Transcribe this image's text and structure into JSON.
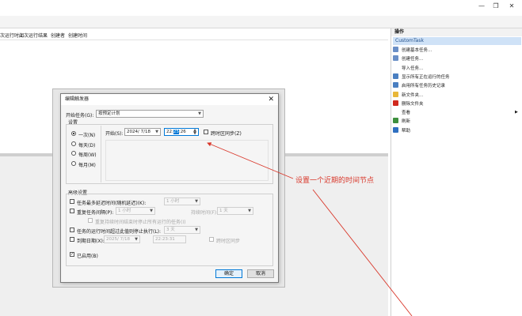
{
  "window": {
    "min": "—",
    "max": "❐",
    "close": "✕"
  },
  "columns": [
    "上次运行时间",
    "上次运行结果",
    "创建者",
    "创建时间"
  ],
  "right_pane": {
    "header": "操作",
    "selected": "CustomTask",
    "items": [
      {
        "icon": "create-basic-task-icon",
        "label": "创建基本任务...",
        "color": "#6a8fc7"
      },
      {
        "icon": "create-task-icon",
        "label": "创建任务...",
        "color": "#6a8fc7"
      },
      {
        "icon": "",
        "label": "导入任务...",
        "color": ""
      },
      {
        "icon": "running-tasks-icon",
        "label": "显示所有正在运行的任务",
        "color": "#4a7fc1"
      },
      {
        "icon": "history-icon",
        "label": "启用所有任务历史记录",
        "color": "#4a7fc1"
      },
      {
        "icon": "new-folder-icon",
        "label": "新文件夹...",
        "color": "#e8b73a"
      },
      {
        "icon": "delete-icon",
        "label": "删除文件夹",
        "color": "#d0281d"
      },
      {
        "icon": "view-icon",
        "label": "查看",
        "color": ""
      },
      {
        "icon": "refresh-icon",
        "label": "刷新",
        "color": "#3d8f3d"
      },
      {
        "icon": "help-icon",
        "label": "帮助",
        "color": "#2f6fc0"
      }
    ]
  },
  "dialog": {
    "title": "编辑触发器",
    "close": "✕",
    "begin_task_label": "开始任务(G):",
    "begin_task_value": "按预定计划",
    "settings_label": "设置",
    "schedule_options": [
      "一次(N)",
      "每天(D)",
      "每周(W)",
      "每月(M)"
    ],
    "selected_option": 0,
    "start_label": "开始(S):",
    "start_date": "2024/ 7/18",
    "start_time_h": "22:",
    "start_time_m": "25",
    "start_time_s": ":26",
    "sync_tz": "跨时区同步(Z)",
    "advanced_label": "高级设置",
    "delay_label": "任务最多延迟时间(随机延迟)(K):",
    "delay_value": "1 小时",
    "repeat_label": "重复任务间隔(P):",
    "repeat_value": "1 小时",
    "duration_label": "持续时间(F):",
    "duration_value": "1 天",
    "stop_at_end_label": "重复持续时间结束时停止所有运行的任务(I)",
    "stop_longer_label": "任务的运行时间超过此值则停止执行(L):",
    "stop_longer_value": "3 天",
    "expire_label": "到期日期(X):",
    "expire_date": "2025/ 7/18",
    "expire_time": "22:23:31",
    "expire_sync": "跨时区同步",
    "enabled_label": "已启用(B)",
    "ok": "确定",
    "cancel": "取消"
  },
  "annotation": {
    "text": "设置一个近期的时间节点",
    "color": "#d9382b"
  }
}
